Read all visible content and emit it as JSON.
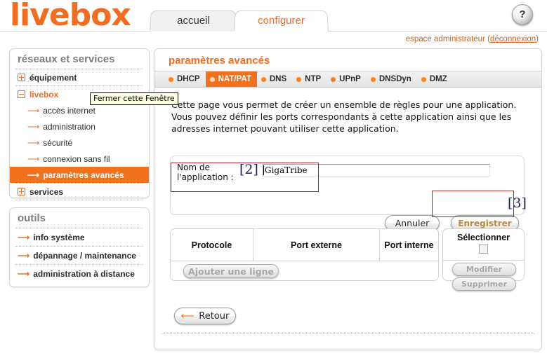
{
  "brand": {
    "logo": "livebox"
  },
  "header": {
    "tabs": [
      {
        "label": "accueil",
        "active": false
      },
      {
        "label": "configurer",
        "active": true
      }
    ],
    "help_icon": "question-mark-icon",
    "help_label": "?",
    "admin_text": "espace administrateur (",
    "admin_link": "déconnexion",
    "admin_text_end": ")"
  },
  "sidebar": {
    "nav": {
      "title": "réseaux et services",
      "items": [
        {
          "label": "équipement",
          "type": "expandable",
          "state": "collapsed"
        },
        {
          "label": "livebox",
          "type": "expandable",
          "state": "expanded"
        },
        {
          "label": "accès internet",
          "type": "child"
        },
        {
          "label": "administration",
          "type": "child"
        },
        {
          "label": "sécurité",
          "type": "child"
        },
        {
          "label": "connexion sans fil",
          "type": "child"
        },
        {
          "label": "paramètres avancés",
          "type": "child",
          "selected": true
        },
        {
          "label": "services",
          "type": "expandable",
          "state": "collapsed"
        }
      ]
    },
    "tools": {
      "title": "outils",
      "items": [
        {
          "label": "info système"
        },
        {
          "label": "dépannage / maintenance"
        },
        {
          "label": "administration à distance"
        }
      ]
    }
  },
  "tooltip": {
    "text": "Fermer cette Fenêtre"
  },
  "main": {
    "title": "paramètres avancés",
    "subtabs": [
      {
        "label": "DHCP",
        "active": false
      },
      {
        "label": "NAT/PAT",
        "active": true
      },
      {
        "label": "DNS",
        "active": false
      },
      {
        "label": "NTP",
        "active": false
      },
      {
        "label": "UPnP",
        "active": false
      },
      {
        "label": "DNSDyn",
        "active": false
      },
      {
        "label": "DMZ",
        "active": false
      }
    ],
    "description": "Cette page vous permet de créer un ensemble de règles pour une application. Vous pouvez définir les ports correspondants à cette application ainsi que les adresses internet pouvant utiliser cette application.",
    "form": {
      "field_label_line1": "Nom de",
      "field_label_line2": "l'application :",
      "input_value": "GigaTribe",
      "input_placeholder": "",
      "cancel_label": "Annuler",
      "save_label": "Enregistrer"
    },
    "table": {
      "headers": [
        "Protocole",
        "Port externe",
        "Port interne"
      ],
      "select_header": "Sélectionner",
      "rows": [],
      "add_row_label": "Ajouter une ligne",
      "edit_label": "Modifier",
      "delete_label": "Supprimer"
    },
    "back_label": "Retour"
  },
  "annotations": [
    {
      "marker": "[2]",
      "target": "application-name-field"
    },
    {
      "marker": "[3]",
      "target": "save-button"
    }
  ],
  "colors": {
    "brand_orange": "#f36d21",
    "selected_orange": "#f2711c",
    "annotation_red": "#9c2b2b",
    "annotation_navy": "#202060",
    "save_text": "#b88b42"
  }
}
